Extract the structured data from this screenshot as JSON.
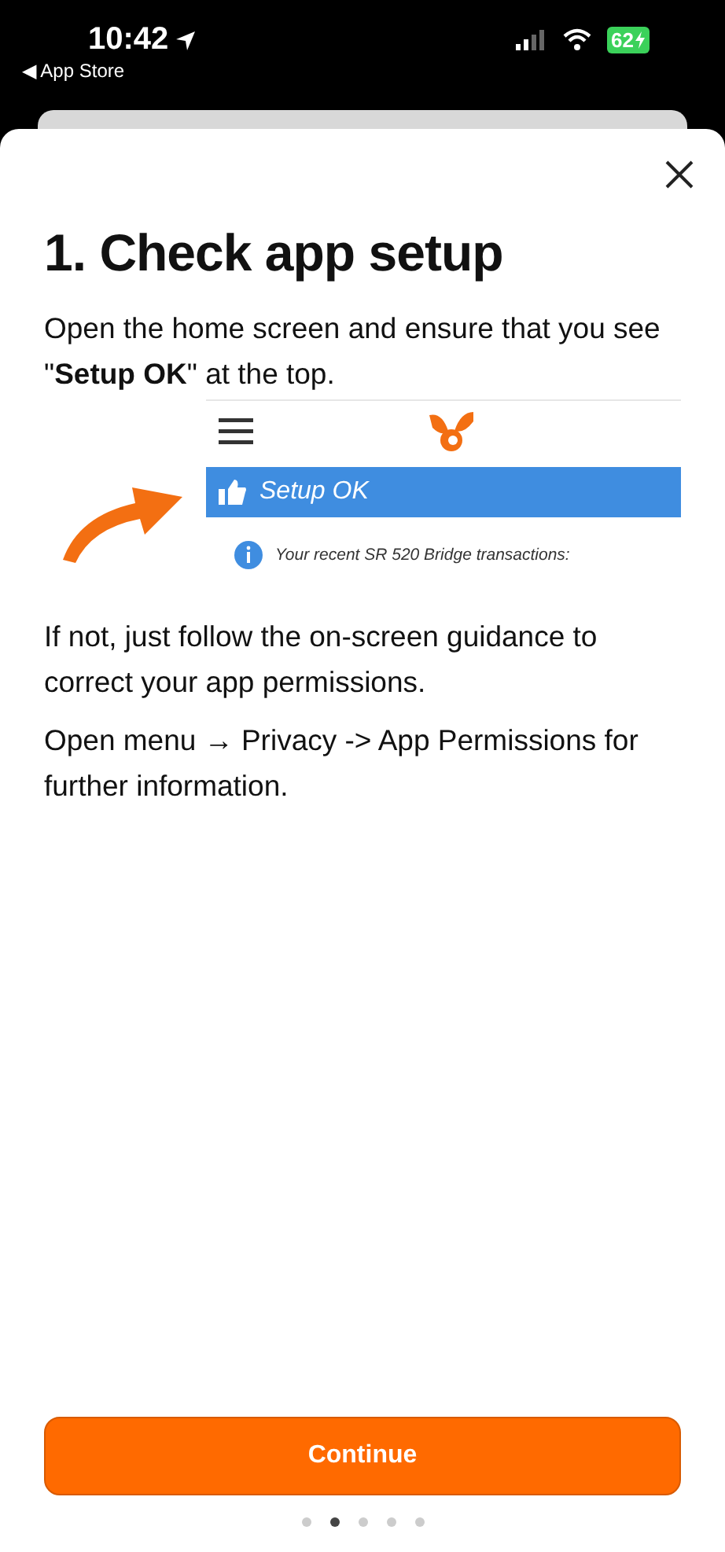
{
  "status_bar": {
    "time": "10:42",
    "back_label": "◀ App Store",
    "battery": "62"
  },
  "title": "1. Check app setup",
  "intro": "Open the home screen and ensure that you see \"**Setup OK**\" at the top.",
  "screenshot": {
    "banner": "Setup OK",
    "notice": "Your recent SR 520 Bridge transactions:"
  },
  "paragraphs": [
    "If not, just follow the on-screen guidance to correct your app permissions.",
    "Open menu → Privacy -> App Permissions for further information."
  ],
  "button": "Continue",
  "pages": [
    {
      "selected": false
    },
    {
      "selected": true
    },
    {
      "selected": false
    },
    {
      "selected": false
    },
    {
      "selected": false
    }
  ]
}
